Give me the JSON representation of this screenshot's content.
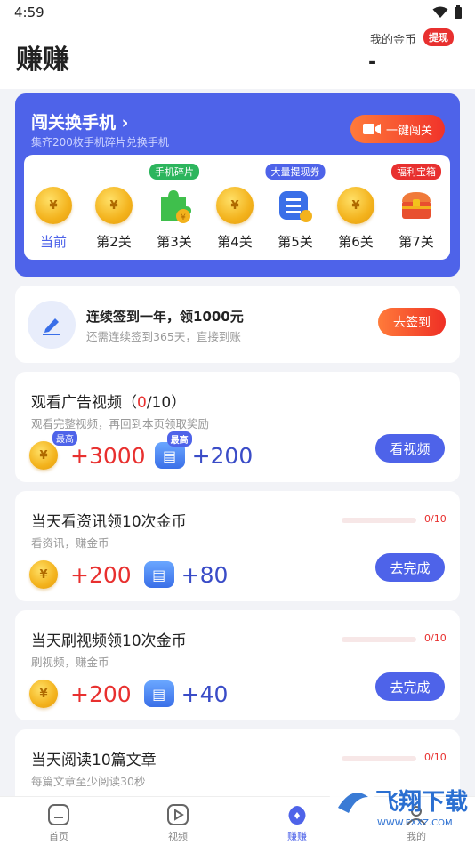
{
  "status": {
    "time": "4:59"
  },
  "header": {
    "title": "赚赚",
    "coins_label": "我的金币",
    "withdraw": "提现",
    "coins_value": "-"
  },
  "level_card": {
    "title": "闯关换手机",
    "subtitle": "集齐200枚手机碎片兑换手机",
    "one_click": "一键闯关",
    "levels": [
      {
        "label": "当前",
        "tag": "",
        "icon": "gold-coin-icon",
        "current": true
      },
      {
        "label": "第2关",
        "tag": "",
        "icon": "gold-coin-icon"
      },
      {
        "label": "第3关",
        "tag": "手机碎片",
        "icon": "puzzle-piece-icon",
        "tag_color": "#2db55d"
      },
      {
        "label": "第4关",
        "tag": "",
        "icon": "gold-coin-icon"
      },
      {
        "label": "第5关",
        "tag": "大量提现券",
        "icon": "cash-ticket-icon",
        "tag_color": "#4e63e9"
      },
      {
        "label": "第6关",
        "tag": "",
        "icon": "gold-coin-icon"
      },
      {
        "label": "第7关",
        "tag": "福利宝箱",
        "icon": "treasure-chest-icon",
        "tag_color": "#e8302f"
      }
    ]
  },
  "signin": {
    "title": "连续签到一年，领1000元",
    "subtitle": "还需连续签到365天，直接到账",
    "button": "去签到"
  },
  "tasks": [
    {
      "title_prefix": "观看广告视频（",
      "count": "0",
      "title_suffix": "/10）",
      "subtitle": "观看完整视频，再回到本页领取奖励",
      "coin_reward": "+3000",
      "ticket_reward": "+200",
      "badge": "最高",
      "button": "看视频"
    },
    {
      "title": "当天看资讯领10次金币",
      "subtitle": "看资讯，赚金币",
      "coin_reward": "+200",
      "ticket_reward": "+80",
      "progress": "0/10",
      "progress_value": 0,
      "button": "去完成"
    },
    {
      "title": "当天刷视频领10次金币",
      "subtitle": "刷视频，赚金币",
      "coin_reward": "+200",
      "ticket_reward": "+40",
      "progress": "0/10",
      "progress_value": 0,
      "button": "去完成"
    },
    {
      "title": "当天阅读10篇文章",
      "subtitle": "每篇文章至少阅读30秒",
      "progress": "0/10",
      "progress_value": 0
    }
  ],
  "tabbar": [
    {
      "label": "首页",
      "icon": "home-icon"
    },
    {
      "label": "视频",
      "icon": "play-icon"
    },
    {
      "label": "赚赚",
      "icon": "earn-icon",
      "active": true
    },
    {
      "label": "我的",
      "icon": "profile-icon"
    }
  ],
  "watermark": {
    "text": "飞翔下载",
    "sub": "WWW.FXXZ.COM"
  }
}
